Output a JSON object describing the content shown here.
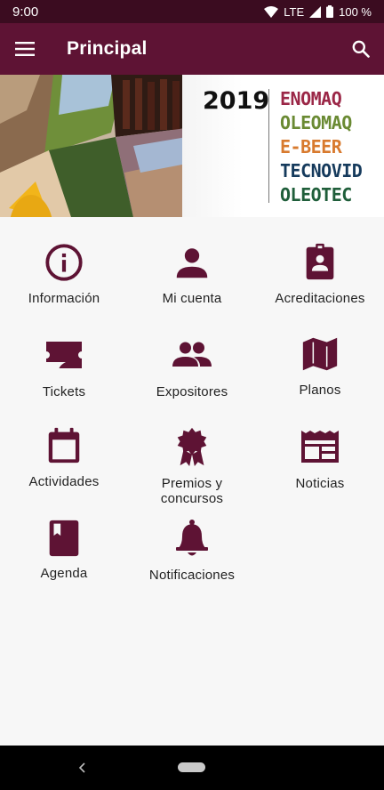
{
  "status_bar": {
    "time": "9:00",
    "network": "LTE",
    "battery": "100 %"
  },
  "app_bar": {
    "title": "Principal",
    "menu_icon": "hamburger-icon",
    "search_icon": "search-icon"
  },
  "banner": {
    "year": "2019",
    "brands": [
      {
        "name": "ENOMAQ",
        "color": "#9b2747"
      },
      {
        "name": "OLEOMAQ",
        "color": "#6a8a33"
      },
      {
        "name": "E-BEER",
        "color": "#d87a2e"
      },
      {
        "name": "TECNOVID",
        "color": "#153a5c"
      },
      {
        "name": "OLEOTEC",
        "color": "#1f5e3a"
      }
    ]
  },
  "menu": {
    "accent": "#5e1334",
    "items": [
      {
        "label": "Información",
        "icon": "info-icon"
      },
      {
        "label": "Mi cuenta",
        "icon": "person-icon"
      },
      {
        "label": "Acreditaciones",
        "icon": "badge-icon"
      },
      {
        "label": "Tickets",
        "icon": "ticket-icon"
      },
      {
        "label": "Expositores",
        "icon": "people-icon"
      },
      {
        "label": "Planos",
        "icon": "map-icon"
      },
      {
        "label": "Actividades",
        "icon": "calendar-icon"
      },
      {
        "label": "Premios y\nconcursos",
        "icon": "award-icon"
      },
      {
        "label": "Noticias",
        "icon": "news-icon"
      },
      {
        "label": "Agenda",
        "icon": "bookmark-book-icon"
      },
      {
        "label": "Notificaciones",
        "icon": "bell-icon"
      }
    ]
  },
  "nav_bar": {
    "back_icon": "back-icon",
    "home_icon": "home-pill-icon"
  }
}
